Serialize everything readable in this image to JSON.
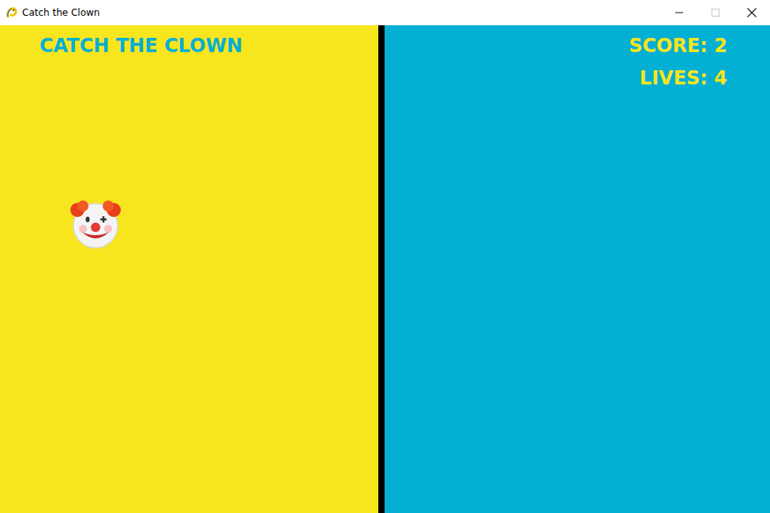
{
  "window": {
    "title": "Catch the Clown",
    "controls": [
      {
        "kind": "minimize",
        "disabled": false
      },
      {
        "kind": "maximize",
        "disabled": true
      },
      {
        "kind": "close",
        "disabled": false
      }
    ]
  },
  "game": {
    "title": "CATCH THE CLOWN",
    "score": "SCORE: 2",
    "lives": "LIVES: 4"
  }
}
